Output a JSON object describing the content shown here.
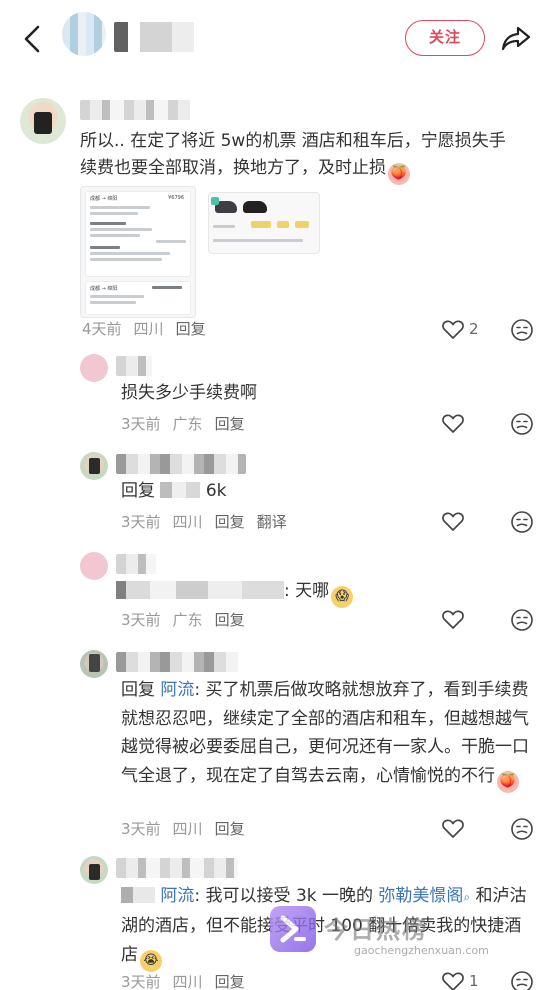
{
  "header": {
    "follow_label": "关注"
  },
  "comments": [
    {
      "text": "所以.. 在定了将近 5w的机票 酒店和租车后，宁愿损失手续费也要全部取消，换地方了，及时止损",
      "emoji": "peach-crying-emoji",
      "time": "4天前",
      "location": "四川",
      "reply_label": "回复",
      "likes": "2",
      "attachments": {
        "flight_price": "¥6796",
        "route_1": "成都 → 绵阳",
        "route_2": "成都 → 绵阳"
      }
    },
    {
      "text": "损失多少手续费啊",
      "time": "3天前",
      "location": "广东",
      "reply_label": "回复"
    },
    {
      "reply_prefix": "回复",
      "text": "6k",
      "time": "3天前",
      "location": "四川",
      "reply_label": "回复",
      "translate_label": "翻译"
    },
    {
      "text": ": 天哪",
      "emoji": "scared-face-emoji",
      "time": "3天前",
      "location": "广东",
      "reply_label": "回复"
    },
    {
      "reply_prefix": "回复",
      "reply_to": "阿流",
      "text": ": 买了机票后做攻略就想放弃了，看到手续费就想忍忍吧，继续定了全部的酒店和租车，但越想越气 越觉得被必要委屈自己，更何况还有一家人。干脆一口气全退了，现在定了自驾去云南，心情愉悦的不行",
      "emoji": "peach-crying-emoji",
      "time": "3天前",
      "location": "四川",
      "reply_label": "回复"
    },
    {
      "reply_to": "阿流",
      "text_before_link": ": 我可以接受 3k 一晚的 ",
      "link_text": "弥勒美憬阁",
      "text_after_link": " 和泸沽湖的酒店，但不能接受平时 100 翻十倍卖我的快捷酒店",
      "emoji": "crying-face-emoji",
      "time": "3天前",
      "location": "四川",
      "reply_label": "回复",
      "likes": "1"
    }
  ],
  "watermark": {
    "title": "今日热榜",
    "url": "gaochengzhenxuan.com"
  },
  "colors": {
    "accent": "#e2475c",
    "link": "#3b74b8",
    "meta": "#999999"
  }
}
